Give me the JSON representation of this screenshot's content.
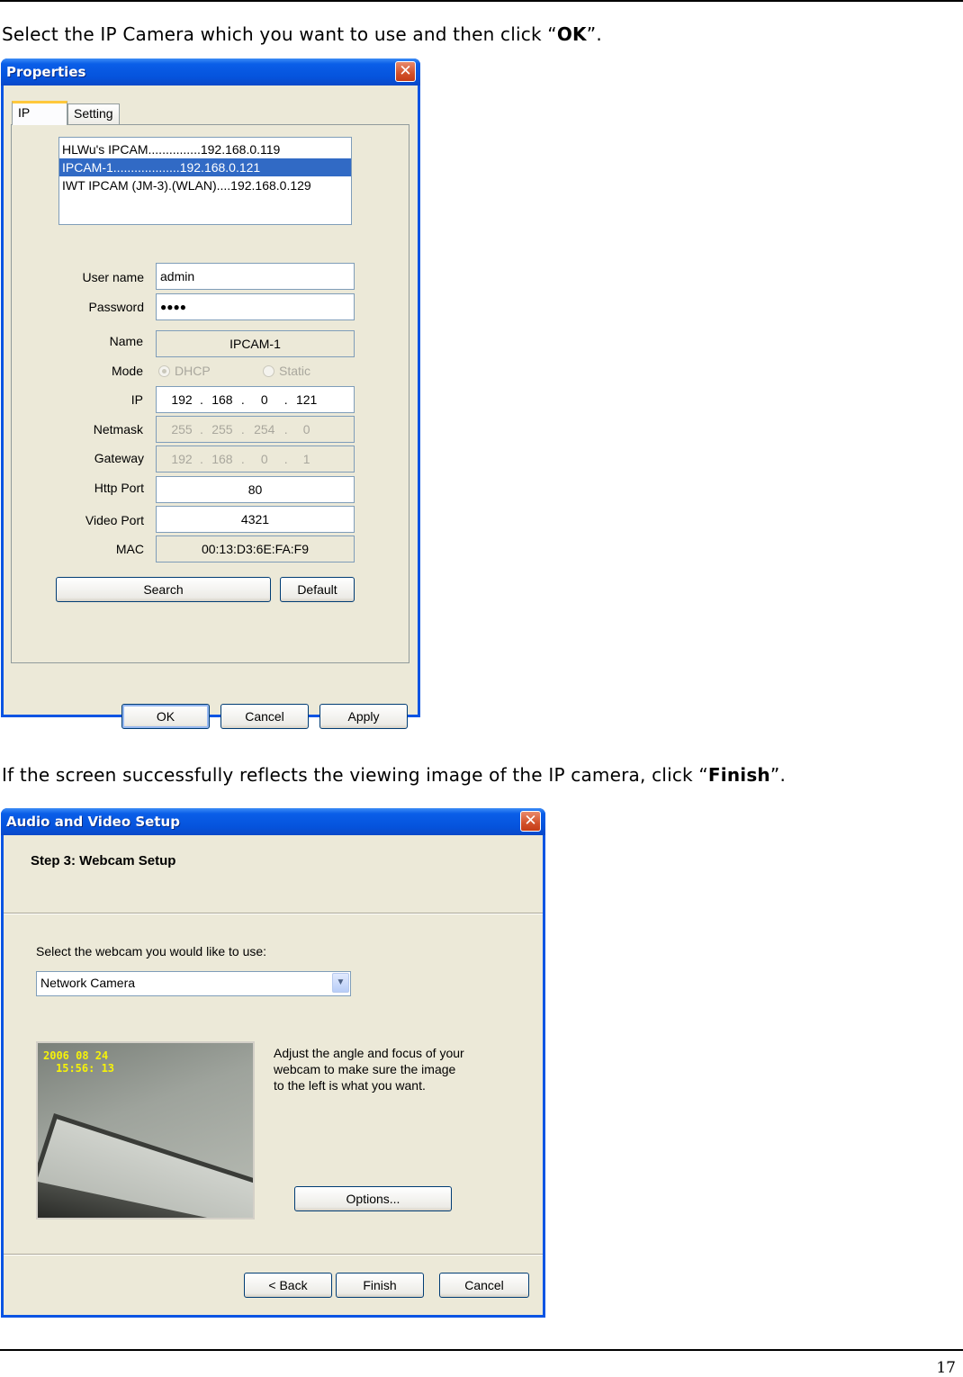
{
  "page": {
    "instruction_1": {
      "before": "Select the IP Camera which you want to use and then click “",
      "bold": "OK",
      "after": "”."
    },
    "instruction_2": {
      "before": "If the screen successfully reflects the viewing image of the IP camera, click “",
      "bold": "Finish",
      "after": "”."
    },
    "page_number": "17"
  },
  "properties_dialog": {
    "title": "Properties",
    "close_glyph": "✕",
    "tabs": [
      {
        "label": "IP",
        "active": true
      },
      {
        "label": "Setting",
        "active": false
      }
    ],
    "camera_list": [
      {
        "text": "HLWu's IPCAM...............192.168.0.119",
        "selected": false
      },
      {
        "text": "IPCAM-1...................192.168.0.121",
        "selected": true
      },
      {
        "text": "IWT IPCAM (JM-3).(WLAN)....192.168.0.129",
        "selected": false
      }
    ],
    "labels": {
      "user_name": "User name",
      "password": "Password",
      "name": "Name",
      "mode": "Mode",
      "ip": "IP",
      "netmask": "Netmask",
      "gateway": "Gateway",
      "http_port": "Http Port",
      "video_port": "Video Port",
      "mac": "MAC"
    },
    "values": {
      "user_name": "admin",
      "password": "●●●●",
      "name": "IPCAM-1",
      "mode_options": [
        {
          "label": "DHCP",
          "selected": true
        },
        {
          "label": "Static",
          "selected": false
        }
      ],
      "ip": [
        "192",
        "168",
        "0",
        "121"
      ],
      "netmask": [
        "255",
        "255",
        "254",
        "0"
      ],
      "gateway": [
        "192",
        "168",
        "0",
        "1"
      ],
      "http_port": "80",
      "video_port": "4321",
      "mac": "00:13:D3:6E:FA:F9"
    },
    "buttons": {
      "search": "Search",
      "default": "Default",
      "ok": "OK",
      "cancel": "Cancel",
      "apply": "Apply"
    }
  },
  "webcam_dialog": {
    "title": "Audio and Video Setup",
    "close_glyph": "✕",
    "step_title": "Step 3: Webcam Setup",
    "select_label": "Select the webcam you would like to use:",
    "selected_webcam": "Network Camera",
    "dropdown_glyph": "▼",
    "preview_timestamp": {
      "date": "2006 08 24",
      "time": "15:56: 13"
    },
    "description": [
      "Adjust the angle and focus of your",
      "webcam to make sure the image",
      "to the left is what you want."
    ],
    "buttons": {
      "options": "Options...",
      "back": "< Back",
      "finish": "Finish",
      "cancel": "Cancel"
    }
  }
}
